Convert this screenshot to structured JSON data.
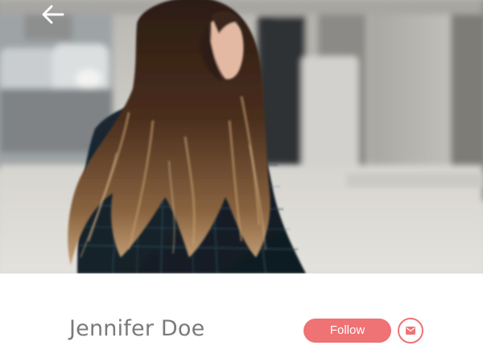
{
  "header": {
    "back_icon": "arrow-left-icon"
  },
  "profile": {
    "name": "Jennifer Doe",
    "follow_label": "Follow",
    "message_icon": "mail-icon"
  },
  "colors": {
    "accent": "#ef7274",
    "name_text": "#7a7a7a",
    "background": "#ffffff"
  }
}
